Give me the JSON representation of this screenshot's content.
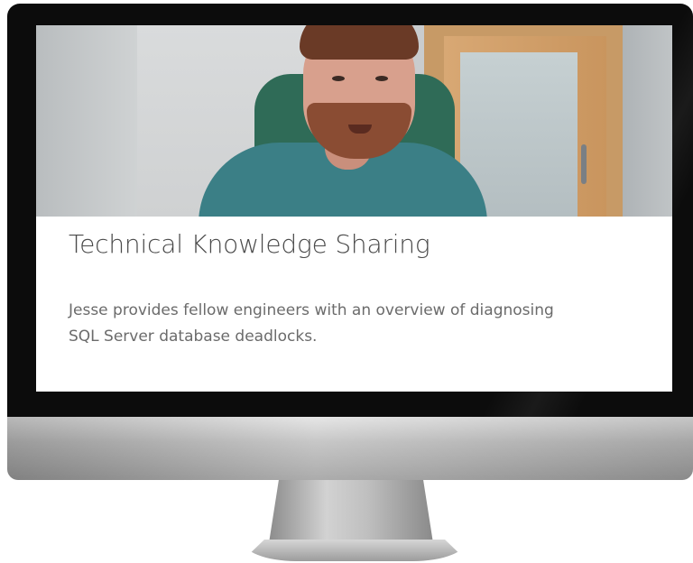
{
  "card": {
    "title": "Technical Knowledge Sharing",
    "description": "Jesse provides fellow engineers with an overview of diagnosing SQL Server database deadlocks."
  },
  "colors": {
    "bezel": "#0c0c0c",
    "screen_background": "#ffffff",
    "title_text": "#4a4a4a",
    "description_text": "#6b6b6b",
    "chin": "#bdbdbd"
  },
  "icons": [
    "video-thumbnail"
  ]
}
